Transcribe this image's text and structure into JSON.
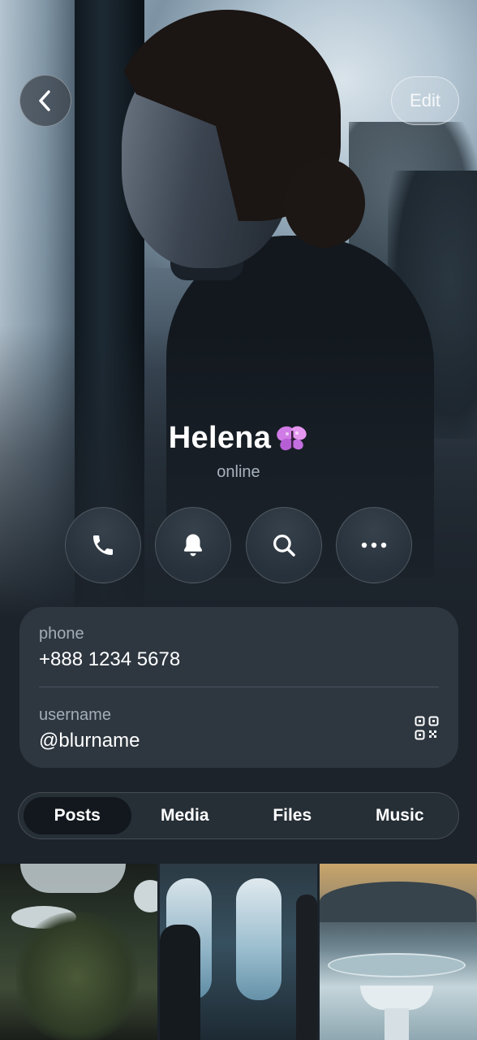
{
  "header": {
    "back_icon": "chevron-left-icon",
    "edit_label": "Edit"
  },
  "profile": {
    "name": "Helena",
    "emoji_icon": "butterfly-emoji",
    "status": "online"
  },
  "actions": [
    {
      "icon": "phone-icon"
    },
    {
      "icon": "bell-icon"
    },
    {
      "icon": "search-icon"
    },
    {
      "icon": "more-icon"
    }
  ],
  "info": {
    "phone_label": "phone",
    "phone_value": "+888 1234 5678",
    "username_label": "username",
    "username_value": "@blurname",
    "qr_icon": "qr-code-icon"
  },
  "tabs": [
    {
      "label": "Posts",
      "active": true
    },
    {
      "label": "Media",
      "active": false
    },
    {
      "label": "Files",
      "active": false
    },
    {
      "label": "Music",
      "active": false
    }
  ],
  "colors": {
    "background": "#1c232b",
    "card": "#2e3740",
    "active_tab": "#12181e"
  }
}
